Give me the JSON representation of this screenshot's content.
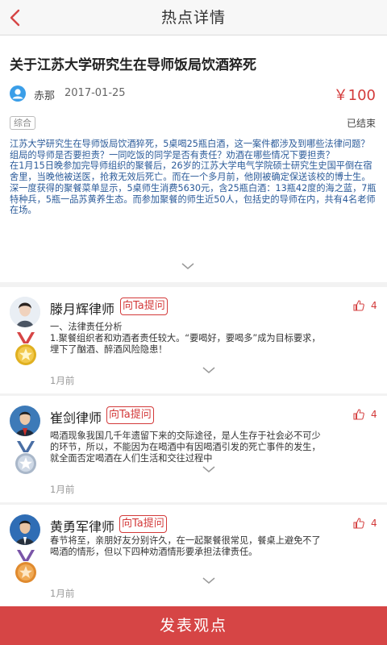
{
  "header": {
    "title": "热点详情"
  },
  "article": {
    "title": "关于江苏大学研究生在导师饭局饮酒猝死",
    "author": "赤那",
    "date": "2017-01-25",
    "price": "￥100",
    "tag": "综合",
    "status": "已结束",
    "paragraphs": [
      "江苏大学研究生在导师饭局饮酒猝死，5桌喝25瓶白酒，这一案件都涉及到哪些法律问题？组局的导师是否要担责？一同吃饭的同学是否有责任？劝酒在哪些情况下要担责？",
      "在1月15日晚参加完导师组织的聚餐后，26岁的江苏大学电气学院硕士研究生史国平倒在宿舍里，当晚他被送医，抢救无效后死亡。而在一个多月前，他刚被确定保送该校的博士生。",
      "深一度获得的聚餐菜单显示，5桌师生消费5630元，含25瓶白酒：13瓶42度的海之蓝，7瓶特种兵，5瓶一品苏黄养生态。而参加聚餐的师生近50人，包括史的导师在内，共有4名老师在场。"
    ]
  },
  "answers": [
    {
      "name": "滕月辉律师",
      "ask_label": "向Ta提问",
      "likes": "4",
      "lines": [
        "一、法律责任分析",
        "1.聚餐组织者和劝酒者责任较大。“要喝好，要喝多”成为目标要求，埋下了酗酒、醉酒风险隐患！"
      ],
      "time": "1月前",
      "medal_color": "#e0b020"
    },
    {
      "name": "崔剑律师",
      "ask_label": "向Ta提问",
      "likes": "4",
      "lines": [
        "喝酒现象我国几千年遗留下来的交际途径，是人生存于社会必不可少的环节，所以，不能因为在喝酒中有因喝酒引发的死亡事件的发生，就全面否定喝酒在人们生活和交往过程中"
      ],
      "time": "1月前",
      "medal_color": "#b8c6d8"
    },
    {
      "name": "黄勇军律师",
      "ask_label": "向Ta提问",
      "likes": "4",
      "lines": [
        "春节将至，亲朋好友分别许久，在一起聚餐很常见，餐桌上避免不了喝酒的情形，但以下四种劝酒情形要承担法律责任。"
      ],
      "time": "1月前",
      "medal_color": "#e7a043"
    }
  ],
  "footer": {
    "button_label": "发表观点"
  },
  "colors": {
    "accent": "#d64545",
    "link_blue": "#2a5a99"
  }
}
